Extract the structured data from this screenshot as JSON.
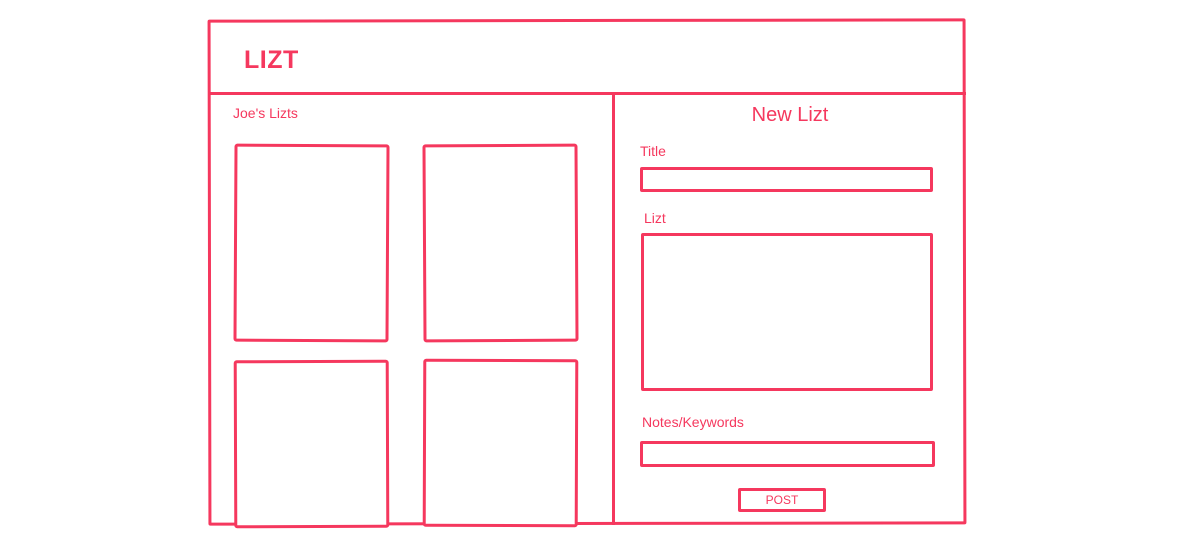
{
  "app": {
    "logo": "LIZT"
  },
  "sidebar": {
    "heading": "Joe's Lizts",
    "cards": [
      {
        "name": "lizt-card-1"
      },
      {
        "name": "lizt-card-2"
      },
      {
        "name": "lizt-card-3"
      },
      {
        "name": "lizt-card-4"
      }
    ]
  },
  "form": {
    "heading": "New Lizt",
    "title_label": "Title",
    "title_value": "",
    "lizt_label": "Lizt",
    "lizt_value": "",
    "notes_label": "Notes/Keywords",
    "notes_value": "",
    "post_label": "POST"
  },
  "colors": {
    "accent": "#f5385e",
    "background": "#ffffff"
  }
}
